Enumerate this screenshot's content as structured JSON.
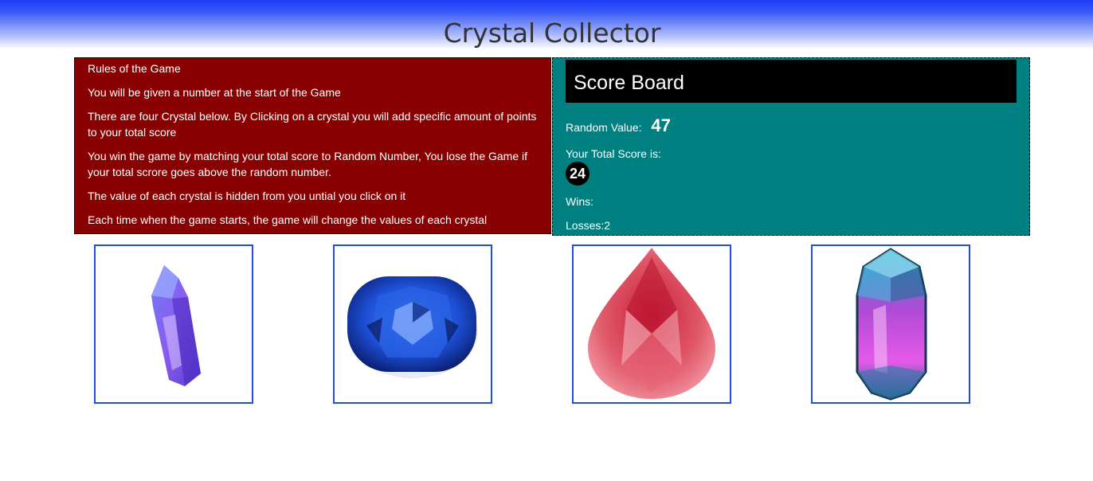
{
  "header": {
    "title": "Crystal Collector"
  },
  "rules": {
    "heading": "Rules of the Game",
    "lines": [
      "You will be given a number at the start of the Game",
      "There are four Crystal below. By Clicking on a crystal you will add specific amount of points to your total score",
      "You win the game by matching your total score to Random Number, You lose the Game if your total scrore goes above the random number.",
      "The value of each crystal is hidden from you untial you click on it",
      "Each time when the game starts, the game will change the values of each crystal"
    ]
  },
  "scoreboard": {
    "title": "Score Board",
    "random_label": "Random Value:",
    "random_value": "47",
    "total_label": "Your Total Score is:",
    "total_value": "24",
    "wins_label": "Wins:",
    "wins_value": "",
    "losses_label": "Losses:",
    "losses_value": "2"
  },
  "crystals": [
    {
      "icon": "purple-quartz-crystal-icon",
      "color": "#7b5cf0"
    },
    {
      "icon": "blue-sapphire-gem-icon",
      "color": "#1d4fd6"
    },
    {
      "icon": "pink-pear-diamond-icon",
      "color": "#e05a6a"
    },
    {
      "icon": "teal-magenta-crystal-icon",
      "color": "#3aa7c7"
    }
  ],
  "colors": {
    "rules_bg": "#880000",
    "scoreboard_bg": "#008080",
    "header_blue": "#1a3cf5",
    "crystal_border": "#1f4fd8"
  }
}
